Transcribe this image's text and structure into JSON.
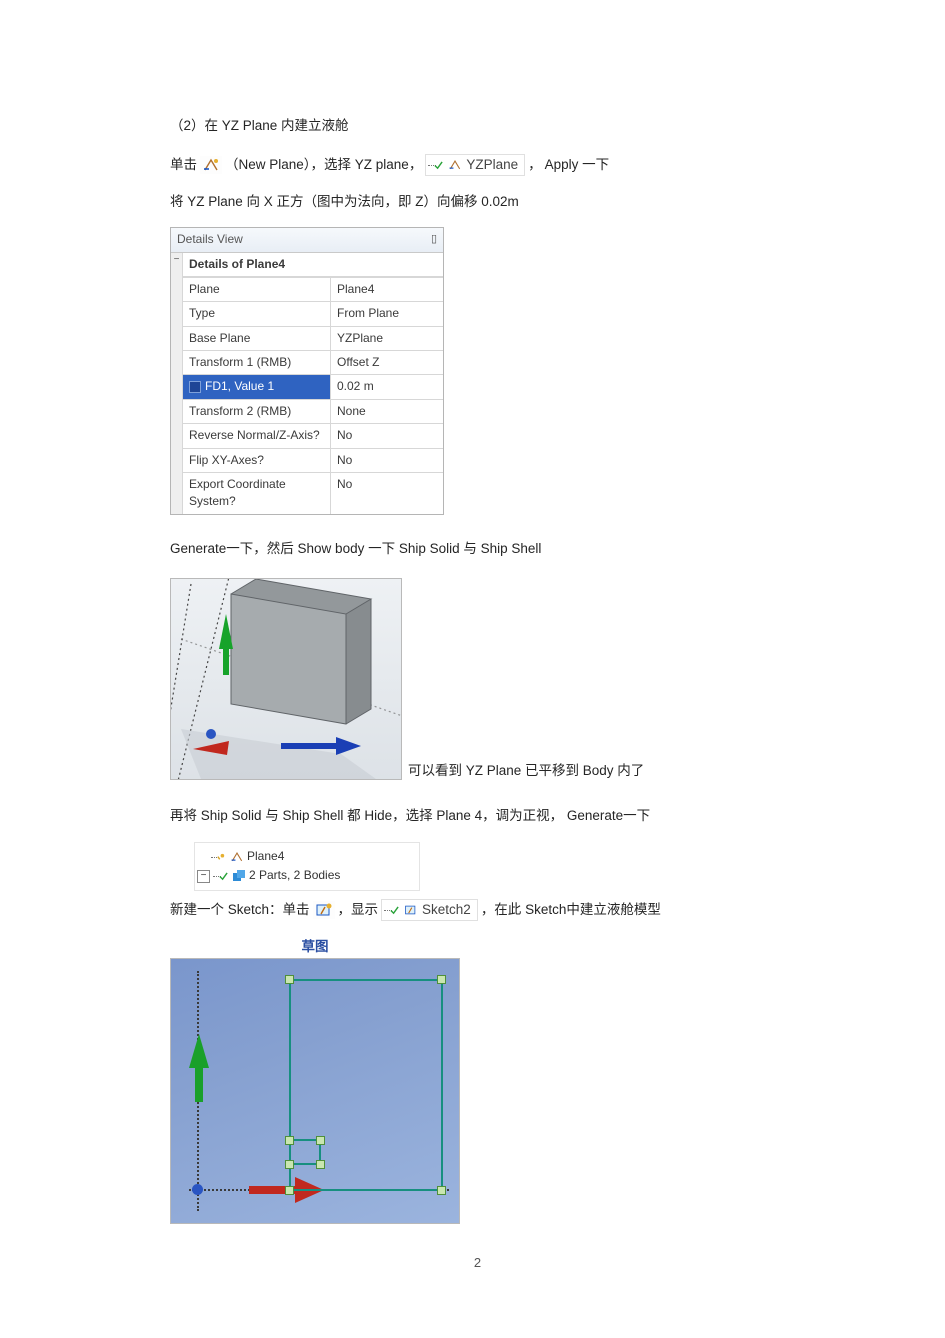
{
  "step": {
    "heading": "（2）在 YZ Plane 内建立液舱"
  },
  "p1": {
    "click": "单击",
    "new_plane_paren": "（New Plane），选择 YZ plane，",
    "yzplane_label": "YZPlane",
    "apply": "， Apply 一下"
  },
  "p2": {
    "text": "将 YZ Plane   向 X 正方（图中为法向，即     Z）向偏移   0.02m"
  },
  "details_view": {
    "panel_title": "Details View",
    "header": "Details of Plane4",
    "rows": [
      {
        "k": "Plane",
        "v": "Plane4"
      },
      {
        "k": "Type",
        "v": "From Plane"
      },
      {
        "k": "Base Plane",
        "v": "YZPlane"
      },
      {
        "k": "Transform 1 (RMB)",
        "v": "Offset Z"
      },
      {
        "k": "FD1, Value 1",
        "v": "0.02 m",
        "selected": true
      },
      {
        "k": "Transform 2 (RMB)",
        "v": "None"
      },
      {
        "k": "Reverse Normal/Z-Axis?",
        "v": "No"
      },
      {
        "k": "Flip XY-Axes?",
        "v": "No"
      },
      {
        "k": "Export Coordinate System?",
        "v": "No"
      }
    ]
  },
  "p3": {
    "text": "Generate一下，然后   Show body  一下 Ship Solid   与 Ship Shell",
    "caption_after": "可以看到   YZ Plane 已平移到   Body 内了"
  },
  "p4": {
    "text": "再将 Ship Solid  与 Ship Shell  都 Hide，选择 Plane 4，调为正视，   Generate一下"
  },
  "tree": {
    "plane_label": "Plane4",
    "parts_label": "2 Parts, 2 Bodies"
  },
  "p5": {
    "pre": "新建一个  Sketch：单击",
    "mid": "，显示",
    "sketch_label": "Sketch2",
    "post": "，在此  Sketch中建立液舱模型"
  },
  "sketch": {
    "title": "草图"
  },
  "page_number": "2"
}
